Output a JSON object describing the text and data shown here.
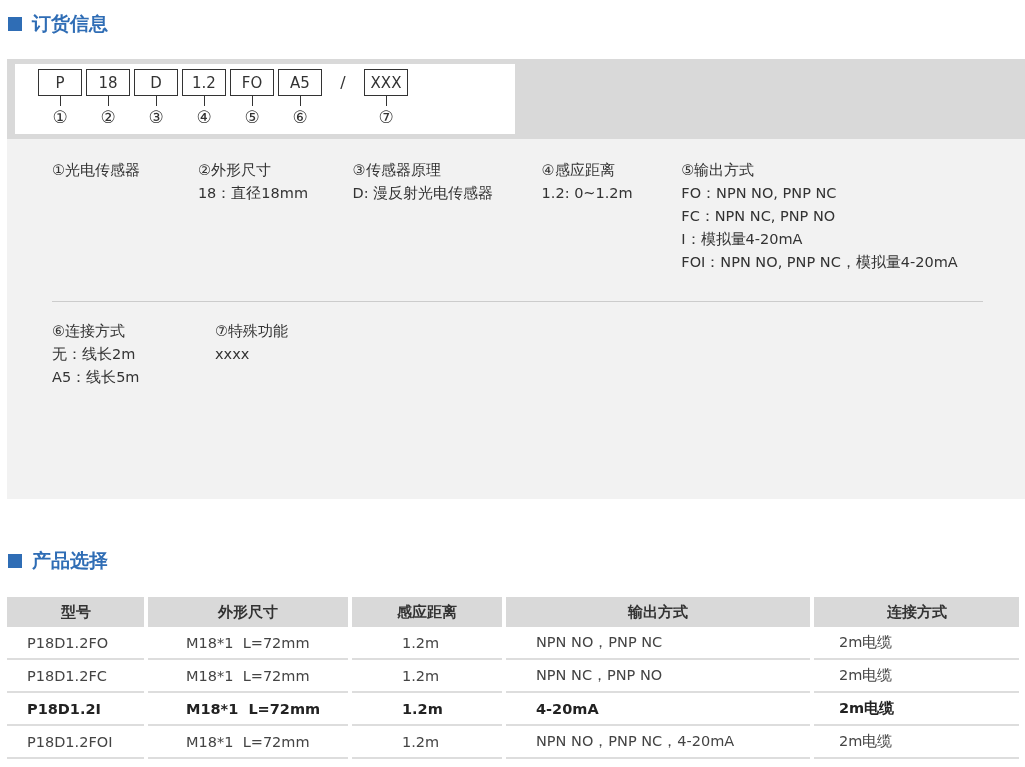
{
  "ordering": {
    "title": "订货信息",
    "code_parts": [
      {
        "kind": "segment",
        "code": "P",
        "number": "①"
      },
      {
        "kind": "segment",
        "code": "18",
        "number": "②"
      },
      {
        "kind": "segment",
        "code": "D",
        "number": "③"
      },
      {
        "kind": "segment",
        "code": "1.2",
        "number": "④"
      },
      {
        "kind": "segment",
        "code": "FO",
        "number": "⑤"
      },
      {
        "kind": "segment",
        "code": "A5",
        "number": "⑥"
      },
      {
        "kind": "separator",
        "code": "/"
      },
      {
        "kind": "segment",
        "code": "XXX",
        "number": "⑦"
      }
    ],
    "legend_rows": [
      [
        {
          "title": "①光电传感器"
        },
        {
          "title": "②外形尺寸",
          "lines": [
            "18：直径18mm"
          ]
        },
        {
          "title": "③传感器原理",
          "lines": [
            "D: 漫反射光电传感器"
          ]
        },
        {
          "title": "④感应距离",
          "lines": [
            "1.2: 0~1.2m"
          ]
        },
        {
          "title": "⑤输出方式",
          "lines": [
            "FO：NPN NO, PNP NC",
            "FC：NPN NC, PNP NO",
            "I：模拟量4-20mA",
            "FOI：NPN NO, PNP NC，模拟量4-20mA"
          ]
        }
      ],
      [
        {
          "title": "⑥连接方式",
          "lines": [
            "无：线长2m",
            "A5：线长5m"
          ]
        },
        {
          "title": "⑦特殊功能",
          "lines": [
            "xxxx"
          ]
        }
      ]
    ]
  },
  "selection": {
    "title": "产品选择",
    "table": {
      "columns": [
        "型号",
        "外形尺寸",
        "感应距离",
        "输出方式",
        "连接方式"
      ],
      "rows": [
        {
          "bold": false,
          "cells": [
            "P18D1.2FO",
            "M18*1  L=72mm",
            "1.2m",
            "NPN NO，PNP NC",
            "2m电缆"
          ]
        },
        {
          "bold": false,
          "cells": [
            "P18D1.2FC",
            "M18*1  L=72mm",
            "1.2m",
            "NPN NC，PNP NO",
            "2m电缆"
          ]
        },
        {
          "bold": true,
          "cells": [
            "P18D1.2I",
            "M18*1  L=72mm",
            "1.2m",
            "4-20mA",
            "2m电缆"
          ]
        },
        {
          "bold": false,
          "cells": [
            "P18D1.2FOI",
            "M18*1  L=72mm",
            "1.2m",
            "NPN NO，PNP NC，4-20mA",
            "2m电缆"
          ]
        }
      ]
    }
  }
}
